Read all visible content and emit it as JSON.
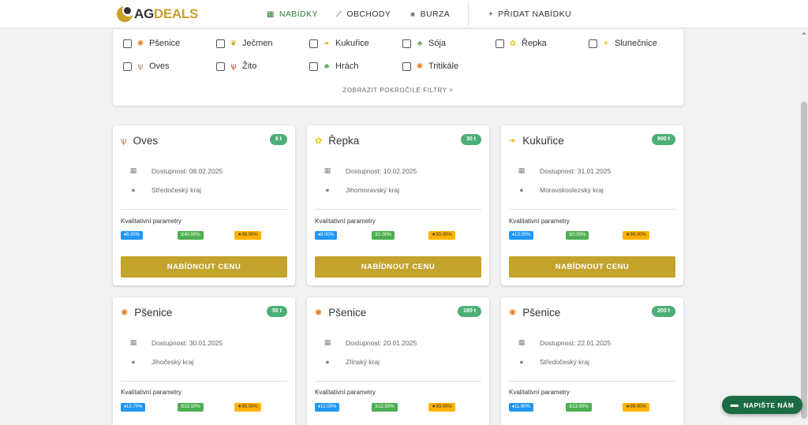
{
  "brand": {
    "ag": "AG",
    "deals": "DEALS"
  },
  "nav": {
    "offers": "NABÍDKY",
    "trades": "OBCHODY",
    "exchange": "BURZA",
    "add_offer": "PŘIDAT NABÍDKU"
  },
  "filter": {
    "crops": [
      "Pšenice",
      "Ječmen",
      "Kukuřice",
      "Sója",
      "Řepka",
      "Slunečnice",
      "Oves",
      "Žito",
      "Hrách",
      "Tritikále"
    ],
    "advanced": "ZOBRAZIT POKROČILÉ FILTRY"
  },
  "card_labels": {
    "availability_prefix": "Dostupnost: ",
    "quality": "Kvalitativní parametry",
    "offer_button": "NABÍDNOUT CENU"
  },
  "cards": [
    {
      "crop": "Oves",
      "qty": "6 t",
      "availability": "Dostupnost: 08.02.2025",
      "region": "Středočeský kraj",
      "p1": "♦8.00%",
      "p2": "⧖40.00%",
      "p3": "★98.00%"
    },
    {
      "crop": "Řepka",
      "qty": "30 t",
      "availability": "Dostupnost: 10.02.2025",
      "region": "Jihomoravský kraj",
      "p1": "♦8.00%",
      "p2": "⧖1.00%",
      "p3": "★90.00%"
    },
    {
      "crop": "Kukuřice",
      "qty": "900 t",
      "availability": "Dostupnost: 31.01.2025",
      "region": "Moravskoslezský kraj",
      "p1": "♦13.00%",
      "p2": "⧖0.00%",
      "p3": "★99.00%"
    },
    {
      "crop": "Pšenice",
      "qty": "50 t",
      "availability": "Dostupnost: 30.01.2025",
      "region": "Jihočeský kraj",
      "p1": "♦12.70%",
      "p2": "⧖13.10%",
      "p3": "★98.00%"
    },
    {
      "crop": "Pšenice",
      "qty": "180 t",
      "availability": "Dostupnost: 20.01.2025",
      "region": "Zlínský kraj",
      "p1": "♦12.00%",
      "p2": "⧖12.50%",
      "p3": "★99.00%"
    },
    {
      "crop": "Pšenice",
      "qty": "200 t",
      "availability": "Dostupnost: 22.01.2025",
      "region": "Středočeský kraj",
      "p1": "♦11.90%",
      "p2": "⧖13.50%",
      "p3": "★99.00%"
    }
  ],
  "chat": {
    "label": "NAPIŠTE NÁM"
  },
  "colors": {
    "accent_gold": "#c4a32d",
    "nav_active": "#2e7d32",
    "qty_badge": "#4caf76",
    "chat": "#1b6b43"
  }
}
